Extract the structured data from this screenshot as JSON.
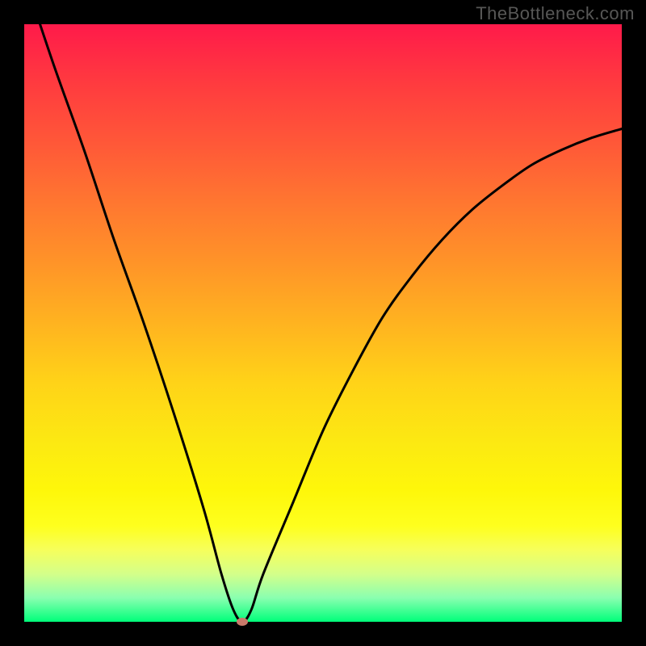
{
  "watermark": "TheBottleneck.com",
  "colors": {
    "background": "#000000",
    "gradient_top": "#ff1a4a",
    "gradient_bottom": "#00ff7a",
    "curve": "#000000",
    "marker": "#c97a6a"
  },
  "chart_data": {
    "type": "line",
    "title": "",
    "xlabel": "",
    "ylabel": "",
    "xlim": [
      0,
      100
    ],
    "ylim": [
      0,
      100
    ],
    "series": [
      {
        "name": "bottleneck-curve",
        "x": [
          0,
          5,
          10,
          15,
          20,
          25,
          30,
          33,
          35,
          36.5,
          38,
          40,
          45,
          50,
          55,
          60,
          65,
          70,
          75,
          80,
          85,
          90,
          95,
          100
        ],
        "y": [
          108,
          93,
          79,
          64,
          50,
          35,
          19,
          8,
          2,
          0,
          2,
          8,
          20,
          32,
          42,
          51,
          58,
          64,
          69,
          73,
          76.5,
          79,
          81,
          82.5
        ]
      }
    ],
    "marker": {
      "x": 36.5,
      "y": 0
    },
    "annotations": [],
    "legend": false,
    "grid": false
  }
}
